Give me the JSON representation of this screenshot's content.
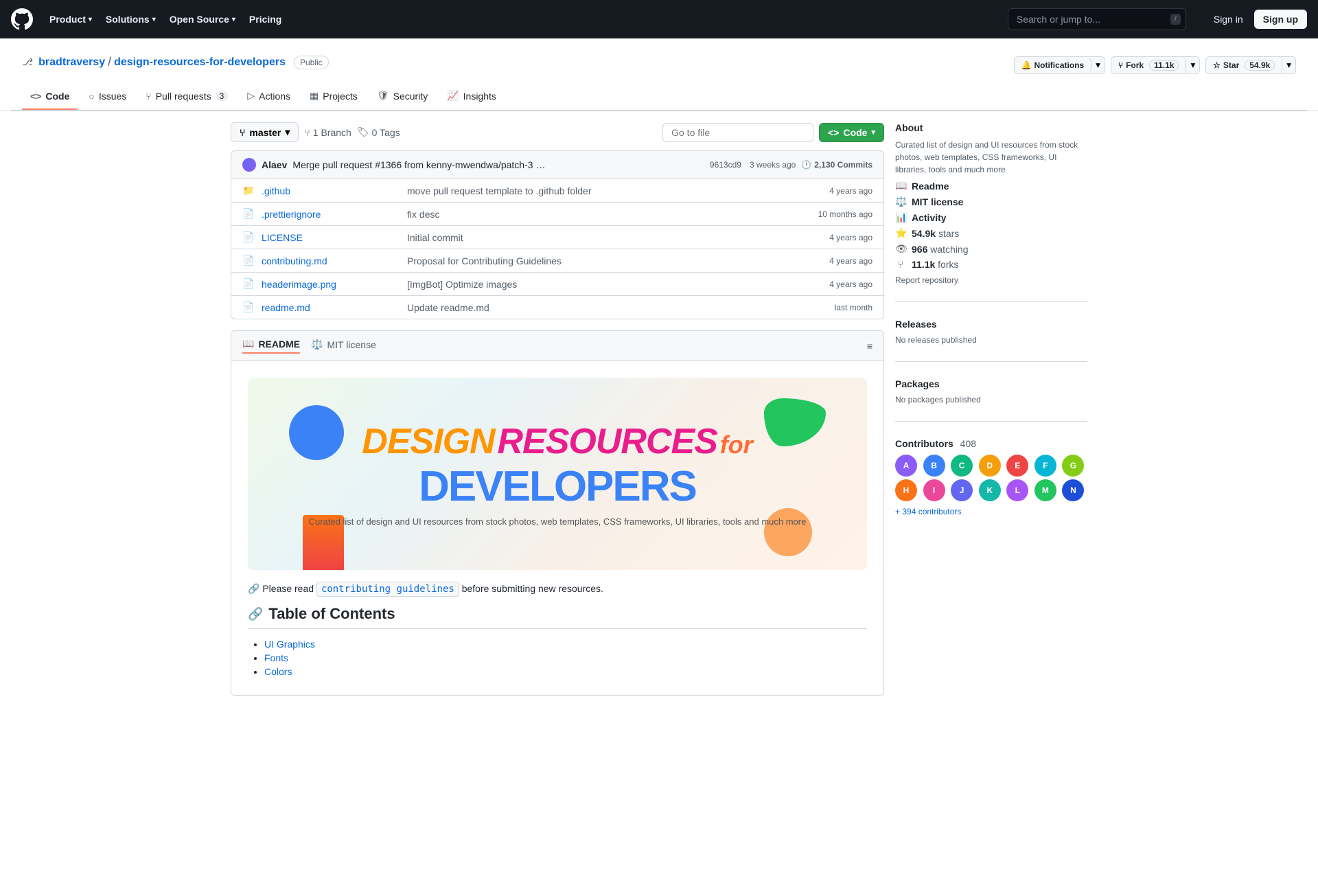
{
  "nav": {
    "logo_label": "GitHub",
    "items": [
      {
        "label": "Product",
        "has_dropdown": true
      },
      {
        "label": "Solutions",
        "has_dropdown": true
      },
      {
        "label": "Open Source",
        "has_dropdown": true
      },
      {
        "label": "Pricing",
        "has_dropdown": false
      }
    ],
    "search_placeholder": "Search or jump to...",
    "search_kbd": "/",
    "signin_label": "Sign in",
    "signup_label": "Sign up"
  },
  "repo": {
    "owner": "bradtraversy",
    "name": "design-resources-for-developers",
    "visibility": "Public",
    "tabs": [
      {
        "label": "Code",
        "icon": "code-icon",
        "count": null,
        "active": true
      },
      {
        "label": "Issues",
        "icon": "issue-icon",
        "count": null,
        "active": false
      },
      {
        "label": "Pull requests",
        "icon": "pr-icon",
        "count": "3",
        "active": false
      },
      {
        "label": "Actions",
        "icon": "actions-icon",
        "count": null,
        "active": false
      },
      {
        "label": "Projects",
        "icon": "projects-icon",
        "count": null,
        "active": false
      },
      {
        "label": "Security",
        "icon": "security-icon",
        "count": null,
        "active": false
      },
      {
        "label": "Insights",
        "icon": "insights-icon",
        "count": null,
        "active": false
      }
    ],
    "actions": {
      "notifications_label": "Notifications",
      "fork_label": "Fork",
      "fork_count": "11.1k",
      "star_label": "Star",
      "star_count": "54.9k"
    }
  },
  "file_browser": {
    "branch": "master",
    "branch_count": "1",
    "branch_label": "Branch",
    "tag_count": "0",
    "tag_label": "Tags",
    "goto_file_placeholder": "Go to file",
    "code_button_label": "Code",
    "commit": {
      "author": "Alaev",
      "message": "Merge pull request #1366 from kenny-mwendwa/patch-3",
      "hash": "9613cd9",
      "time": "3 weeks ago",
      "total_commits": "2,130 Commits"
    },
    "files": [
      {
        "type": "dir",
        "name": ".github",
        "message": "move pull request template to .github folder",
        "time": "4 years ago"
      },
      {
        "type": "file",
        "name": ".prettierignore",
        "message": "fix desc",
        "time": "10 months ago"
      },
      {
        "type": "file",
        "name": "LICENSE",
        "message": "Initial commit",
        "time": "4 years ago"
      },
      {
        "type": "file",
        "name": "contributing.md",
        "message": "Proposal for Contributing Guidelines",
        "time": "4 years ago"
      },
      {
        "type": "file",
        "name": "headerimage.png",
        "message": "[ImgBot] Optimize images",
        "time": "4 years ago"
      },
      {
        "type": "file",
        "name": "readme.md",
        "message": "Update readme.md",
        "time": "last month"
      }
    ]
  },
  "readme": {
    "tab1_label": "README",
    "tab2_label": "MIT license",
    "banner_title_line1_a": "DESIGN",
    "banner_title_line1_b": "RESOURCES",
    "banner_title_line1_c": "for",
    "banner_title_line2": "DEVELOPERS",
    "banner_subtitle": "Curated list of design and UI resources from stock photos, web templates, CSS frameworks, UI libraries, tools and much more",
    "contributing_text_before": "Please read ",
    "contributing_link_label": "contributing guidelines",
    "contributing_text_after": " before submitting new resources.",
    "toc_title": "Table of Contents",
    "toc_items": [
      {
        "label": "UI Graphics",
        "href": "#"
      },
      {
        "label": "Fonts",
        "href": "#"
      },
      {
        "label": "Colors",
        "href": "#"
      }
    ]
  },
  "sidebar": {
    "about_title": "About",
    "about_desc": "Curated list of design and UI resources from stock photos, web templates, CSS frameworks, UI libraries, tools and much more",
    "meta_items": [
      {
        "icon": "book-icon",
        "label": "Readme"
      },
      {
        "icon": "balance-icon",
        "label": "MIT license"
      },
      {
        "icon": "activity-icon",
        "label": "Activity"
      },
      {
        "icon": "star-icon",
        "label": "54.9k",
        "suffix": "stars"
      },
      {
        "icon": "eye-icon",
        "label": "966",
        "suffix": "watching"
      },
      {
        "icon": "fork-icon",
        "label": "11.1k",
        "suffix": "forks"
      }
    ],
    "report_label": "Report repository",
    "releases_title": "Releases",
    "releases_empty": "No releases published",
    "packages_title": "Packages",
    "packages_empty": "No packages published",
    "contributors_title": "Contributors",
    "contributors_count": "408",
    "contributors_more_label": "+ 394 contributors",
    "contributor_count_display": 14
  }
}
